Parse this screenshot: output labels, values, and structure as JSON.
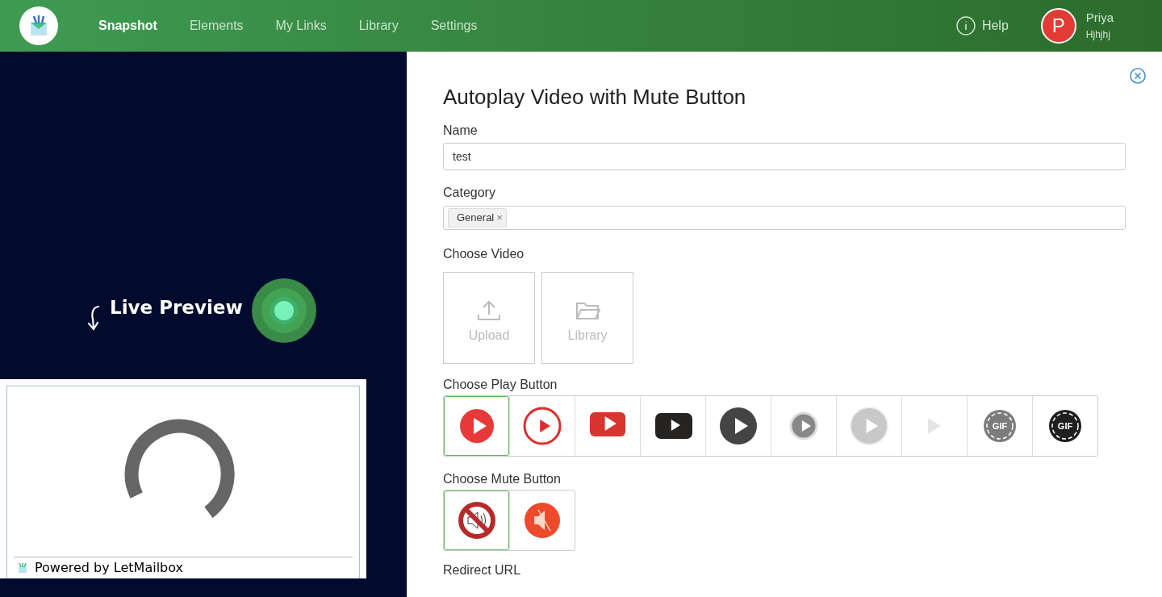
{
  "nav": {
    "items": [
      {
        "label": "Snapshot",
        "selected": true
      },
      {
        "label": "Elements",
        "selected": false
      },
      {
        "label": "My Links",
        "selected": false
      },
      {
        "label": "Library",
        "selected": false
      },
      {
        "label": "Settings",
        "selected": false
      }
    ],
    "help": "Help",
    "user": {
      "initial": "P",
      "name": "Priya",
      "subtitle": "Hjhjhj"
    }
  },
  "live_preview": {
    "label": "Live Preview",
    "footer": "Powered by LetMailbox"
  },
  "form": {
    "title": "Autoplay Video with Mute Button",
    "name": {
      "label": "Name",
      "value": "test"
    },
    "category": {
      "label": "Category",
      "tags": [
        "General"
      ],
      "remove": "×"
    },
    "video": {
      "label": "Choose Video",
      "options": [
        {
          "kind": "upload",
          "label": "Upload"
        },
        {
          "kind": "library",
          "label": "Library"
        }
      ]
    },
    "play_buttons": {
      "label": "Choose Play Button",
      "options": [
        {
          "kind": "red-circle",
          "selected": true
        },
        {
          "kind": "red-ring",
          "selected": false
        },
        {
          "kind": "red-rect",
          "selected": false
        },
        {
          "kind": "black-rect",
          "selected": false
        },
        {
          "kind": "dark-circle",
          "selected": false
        },
        {
          "kind": "small-grey",
          "selected": false
        },
        {
          "kind": "light-grey",
          "selected": false
        },
        {
          "kind": "faint",
          "selected": false
        },
        {
          "kind": "gif-grey",
          "selected": false,
          "text": "GIF"
        },
        {
          "kind": "gif-black",
          "selected": false,
          "text": "GIF"
        }
      ]
    },
    "mute_buttons": {
      "label": "Choose Mute Button",
      "options": [
        {
          "kind": "no-sound",
          "selected": true
        },
        {
          "kind": "orange-mute",
          "selected": false
        }
      ]
    },
    "redirect": {
      "label": "Redirect URL"
    }
  }
}
